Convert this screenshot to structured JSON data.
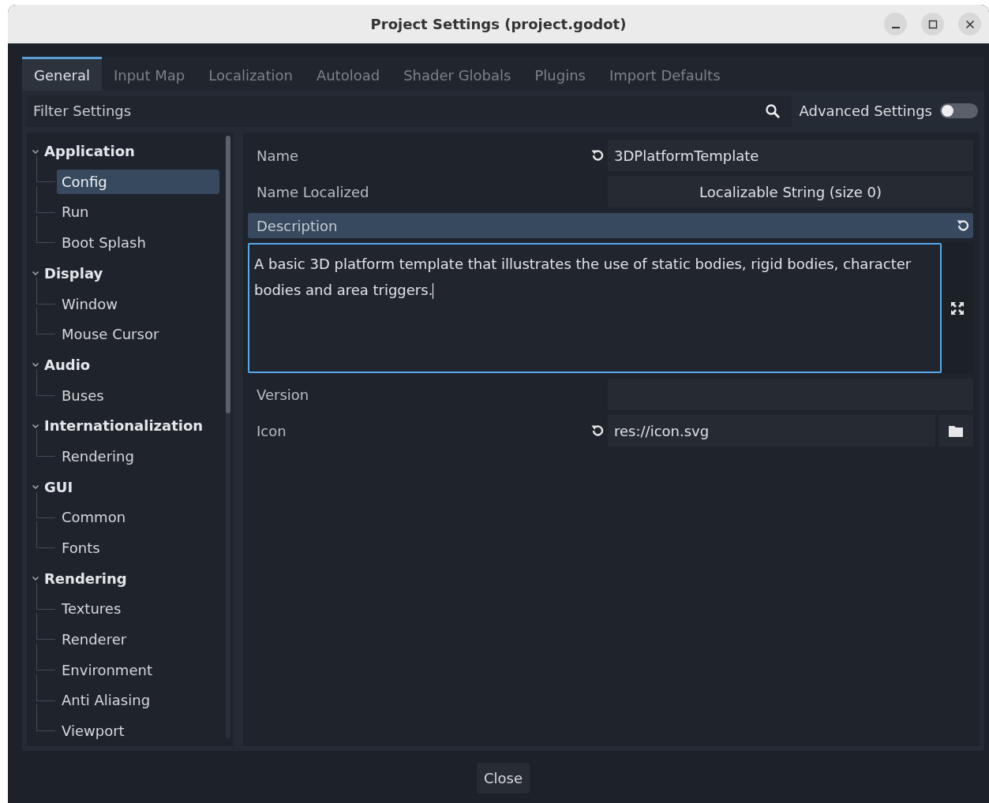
{
  "window": {
    "title": "Project Settings (project.godot)"
  },
  "tabs": [
    {
      "label": "General",
      "selected": true
    },
    {
      "label": "Input Map",
      "selected": false
    },
    {
      "label": "Localization",
      "selected": false
    },
    {
      "label": "Autoload",
      "selected": false
    },
    {
      "label": "Shader Globals",
      "selected": false
    },
    {
      "label": "Plugins",
      "selected": false
    },
    {
      "label": "Import Defaults",
      "selected": false
    }
  ],
  "filter": {
    "placeholder": "Filter Settings"
  },
  "advanced": {
    "label": "Advanced Settings",
    "on": false
  },
  "tree": [
    {
      "label": "Application",
      "expanded": true,
      "selected": false,
      "children": [
        {
          "label": "Config",
          "selected": true
        },
        {
          "label": "Run",
          "selected": false
        },
        {
          "label": "Boot Splash",
          "selected": false
        }
      ]
    },
    {
      "label": "Display",
      "expanded": true,
      "selected": false,
      "children": [
        {
          "label": "Window",
          "selected": false
        },
        {
          "label": "Mouse Cursor",
          "selected": false
        }
      ]
    },
    {
      "label": "Audio",
      "expanded": true,
      "selected": false,
      "children": [
        {
          "label": "Buses",
          "selected": false
        }
      ]
    },
    {
      "label": "Internationalization",
      "expanded": true,
      "selected": false,
      "children": [
        {
          "label": "Rendering",
          "selected": false
        }
      ]
    },
    {
      "label": "GUI",
      "expanded": true,
      "selected": false,
      "children": [
        {
          "label": "Common",
          "selected": false
        },
        {
          "label": "Fonts",
          "selected": false
        }
      ]
    },
    {
      "label": "Rendering",
      "expanded": true,
      "selected": false,
      "children": [
        {
          "label": "Textures",
          "selected": false
        },
        {
          "label": "Renderer",
          "selected": false
        },
        {
          "label": "Environment",
          "selected": false
        },
        {
          "label": "Anti Aliasing",
          "selected": false
        },
        {
          "label": "Viewport",
          "selected": false
        }
      ]
    }
  ],
  "properties": [
    {
      "kind": "text",
      "label": "Name",
      "value": "3DPlatformTemplate",
      "revertable": true,
      "selected": false
    },
    {
      "kind": "button",
      "label": "Name Localized",
      "value": "Localizable String (size 0)",
      "revertable": false,
      "selected": false
    },
    {
      "kind": "multiline",
      "label": "Description",
      "value": "A basic 3D platform template that illustrates the use of static bodies, rigid bodies, character bodies and area triggers.",
      "revertable": true,
      "selected": true
    },
    {
      "kind": "text",
      "label": "Version",
      "revertable": false,
      "selected": false
    },
    {
      "kind": "file",
      "label": "Icon",
      "value": "res://icon.svg",
      "revertable": true,
      "selected": false
    }
  ],
  "close_button": "Close"
}
